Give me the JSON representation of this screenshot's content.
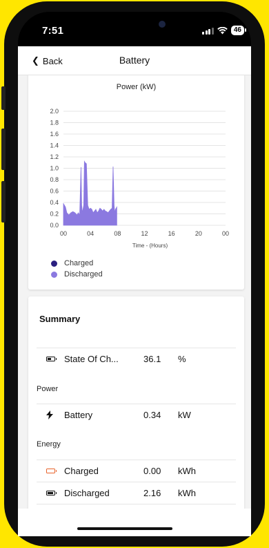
{
  "status": {
    "time": "7:51",
    "battery": "46"
  },
  "nav": {
    "back_label": "Back",
    "title": "Battery"
  },
  "chart_data": {
    "type": "area",
    "title": "Power (kW)",
    "xlabel": "Time - (Hours)",
    "ylabel": "",
    "x_tick_labels": [
      "00",
      "04",
      "08",
      "12",
      "16",
      "20",
      "00"
    ],
    "y_tick_labels": [
      "0.0",
      "0.2",
      "0.4",
      "0.6",
      "0.8",
      "1.0",
      "1.2",
      "1.4",
      "1.6",
      "1.8",
      "2.0"
    ],
    "xlim": [
      0,
      24
    ],
    "ylim": [
      0,
      2.0
    ],
    "legend_position": "bottom-left",
    "series": [
      {
        "name": "Charged",
        "color": "#2a1f80",
        "x": [],
        "y": []
      },
      {
        "name": "Discharged",
        "color": "#8b79e0",
        "x": [
          0,
          0.1,
          0.3,
          0.5,
          0.8,
          1.1,
          1.4,
          1.7,
          2.0,
          2.2,
          2.4,
          2.6,
          2.7,
          2.8,
          3.0,
          3.1,
          3.2,
          3.4,
          3.6,
          3.8,
          4.0,
          4.2,
          4.4,
          4.6,
          4.8,
          5.0,
          5.2,
          5.4,
          5.6,
          5.8,
          6.0,
          6.2,
          6.4,
          6.6,
          6.8,
          7.0,
          7.2,
          7.35,
          7.5,
          7.6,
          7.7,
          7.8,
          7.9
        ],
        "y": [
          0.38,
          0.36,
          0.32,
          0.22,
          0.18,
          0.22,
          0.24,
          0.22,
          0.18,
          0.22,
          0.18,
          1.02,
          0.35,
          0.22,
          0.35,
          1.12,
          1.1,
          1.08,
          0.35,
          0.28,
          0.3,
          0.28,
          0.22,
          0.25,
          0.28,
          0.22,
          0.25,
          0.3,
          0.28,
          0.25,
          0.28,
          0.25,
          0.24,
          0.22,
          0.25,
          0.28,
          0.3,
          1.03,
          0.35,
          0.22,
          0.28,
          0.3,
          0.32
        ]
      }
    ]
  },
  "summary": {
    "title": "Summary",
    "power_label": "Power",
    "energy_label": "Energy",
    "rows": [
      {
        "label": "State Of Ch...",
        "value": "36.1",
        "unit": "%",
        "icon": "battery-half-icon"
      },
      {
        "label": "Battery",
        "value": "0.34",
        "unit": "kW",
        "icon": "lightning-icon"
      },
      {
        "label": "Charged",
        "value": "0.00",
        "unit": "kWh",
        "icon": "battery-empty-icon",
        "icon_color": "#e8622a"
      },
      {
        "label": "Discharged",
        "value": "2.16",
        "unit": "kWh",
        "icon": "battery-full-icon"
      }
    ]
  }
}
